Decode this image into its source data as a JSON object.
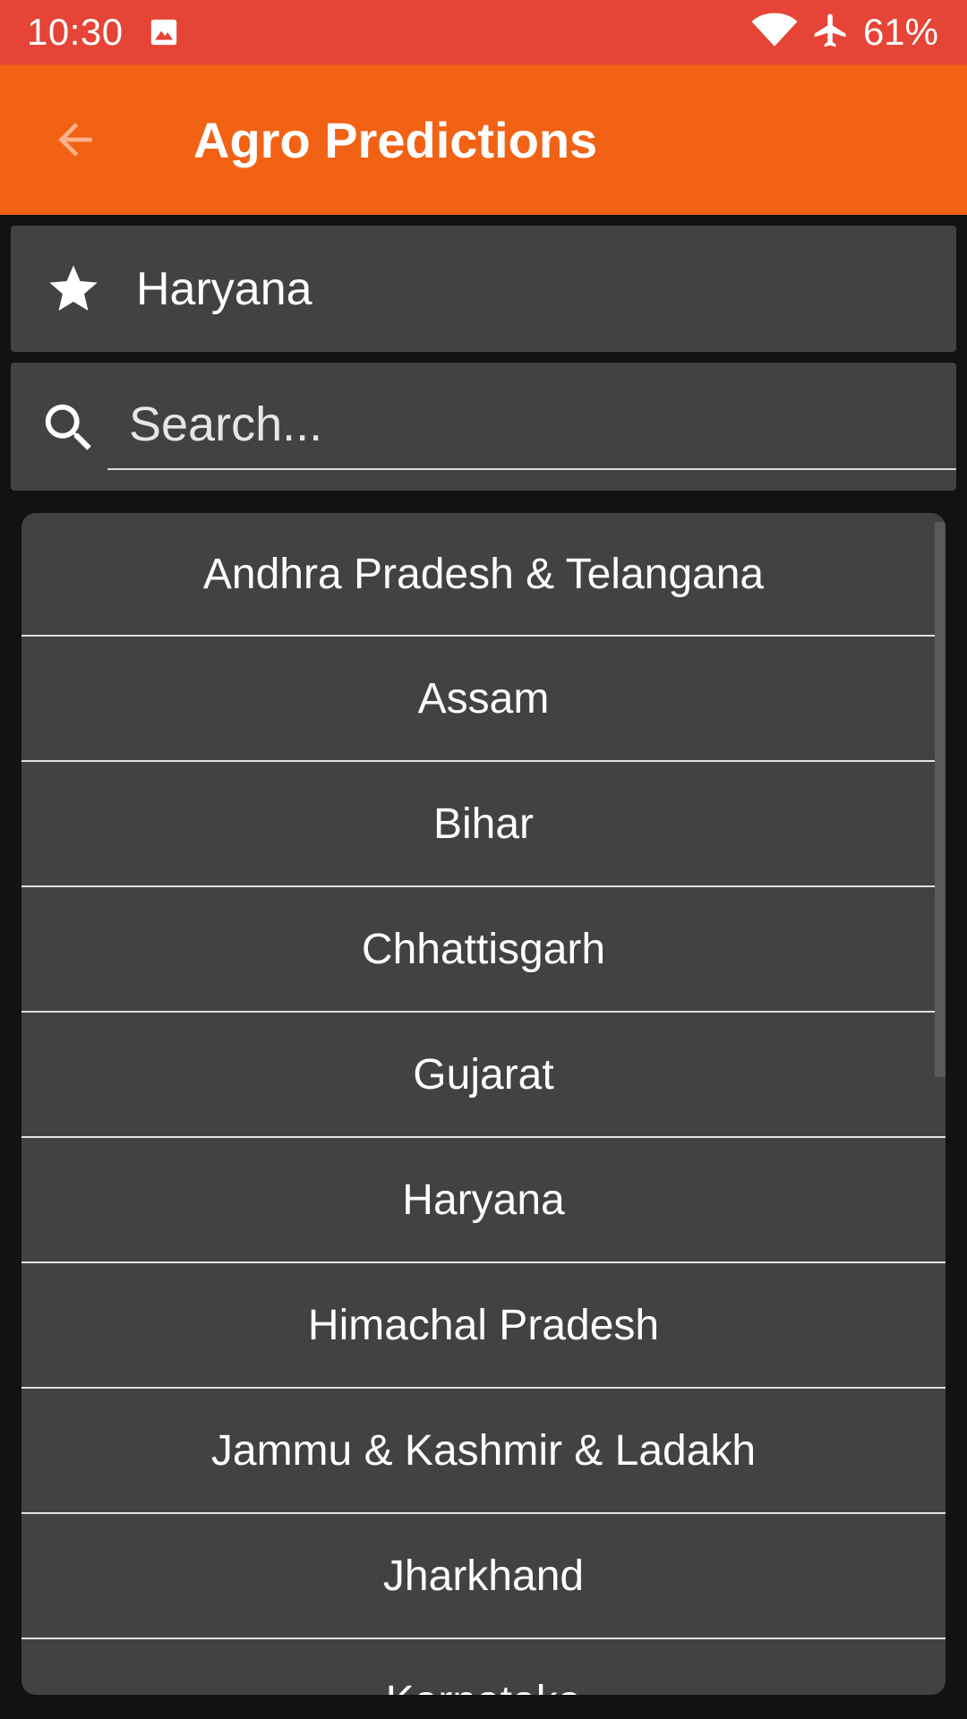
{
  "status_bar": {
    "time": "10:30",
    "battery": "61%",
    "icons": [
      "image-icon",
      "wifi-icon",
      "airplane-mode-icon"
    ]
  },
  "app_bar": {
    "title": "Agro Predictions",
    "back_icon": "arrow-back-icon"
  },
  "favorite": {
    "icon": "star-icon",
    "label": "Haryana"
  },
  "search": {
    "placeholder": "Search...",
    "value": ""
  },
  "states": [
    "Andhra Pradesh & Telangana",
    "Assam",
    "Bihar",
    "Chhattisgarh",
    "Gujarat",
    "Haryana",
    "Himachal Pradesh",
    "Jammu & Kashmir & Ladakh",
    "Jharkhand",
    "Karnataka"
  ],
  "colors": {
    "status_bar": "#e54436",
    "app_bar": "#f26215",
    "card": "#424242",
    "background": "#121212"
  }
}
